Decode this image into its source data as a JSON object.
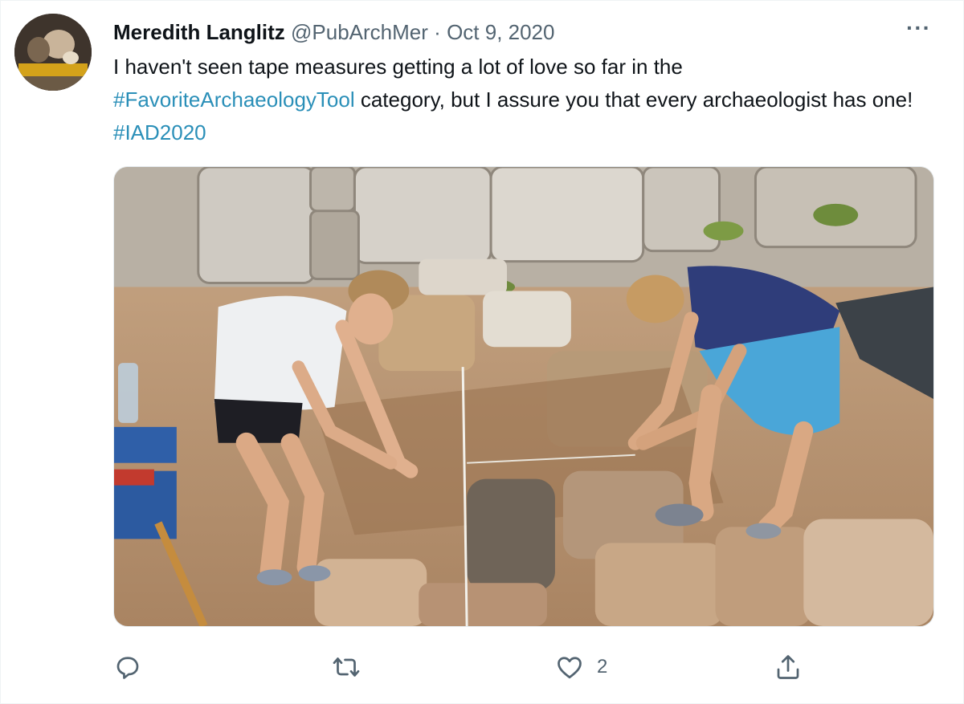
{
  "tweet": {
    "author_name": "Meredith Langlitz",
    "handle": "@PubArchMer",
    "separator": "·",
    "date": "Oct 9, 2020",
    "more_label": "···",
    "text": {
      "part1": "I haven't seen tape measures getting a lot of love so far in the ",
      "hashtag1": "#FavoriteArchaeologyTool",
      "part2": " category, but I assure you that every archaeologist has one! ",
      "hashtag2": "#IAD2020"
    }
  },
  "actions": {
    "reply_icon": "reply-icon",
    "retweet_icon": "retweet-icon",
    "like_icon": "heart-icon",
    "like_count": "2",
    "share_icon": "share-icon"
  },
  "colors": {
    "text": "#0f1419",
    "secondary": "#536471",
    "hashtag": "#2a8fb8"
  }
}
